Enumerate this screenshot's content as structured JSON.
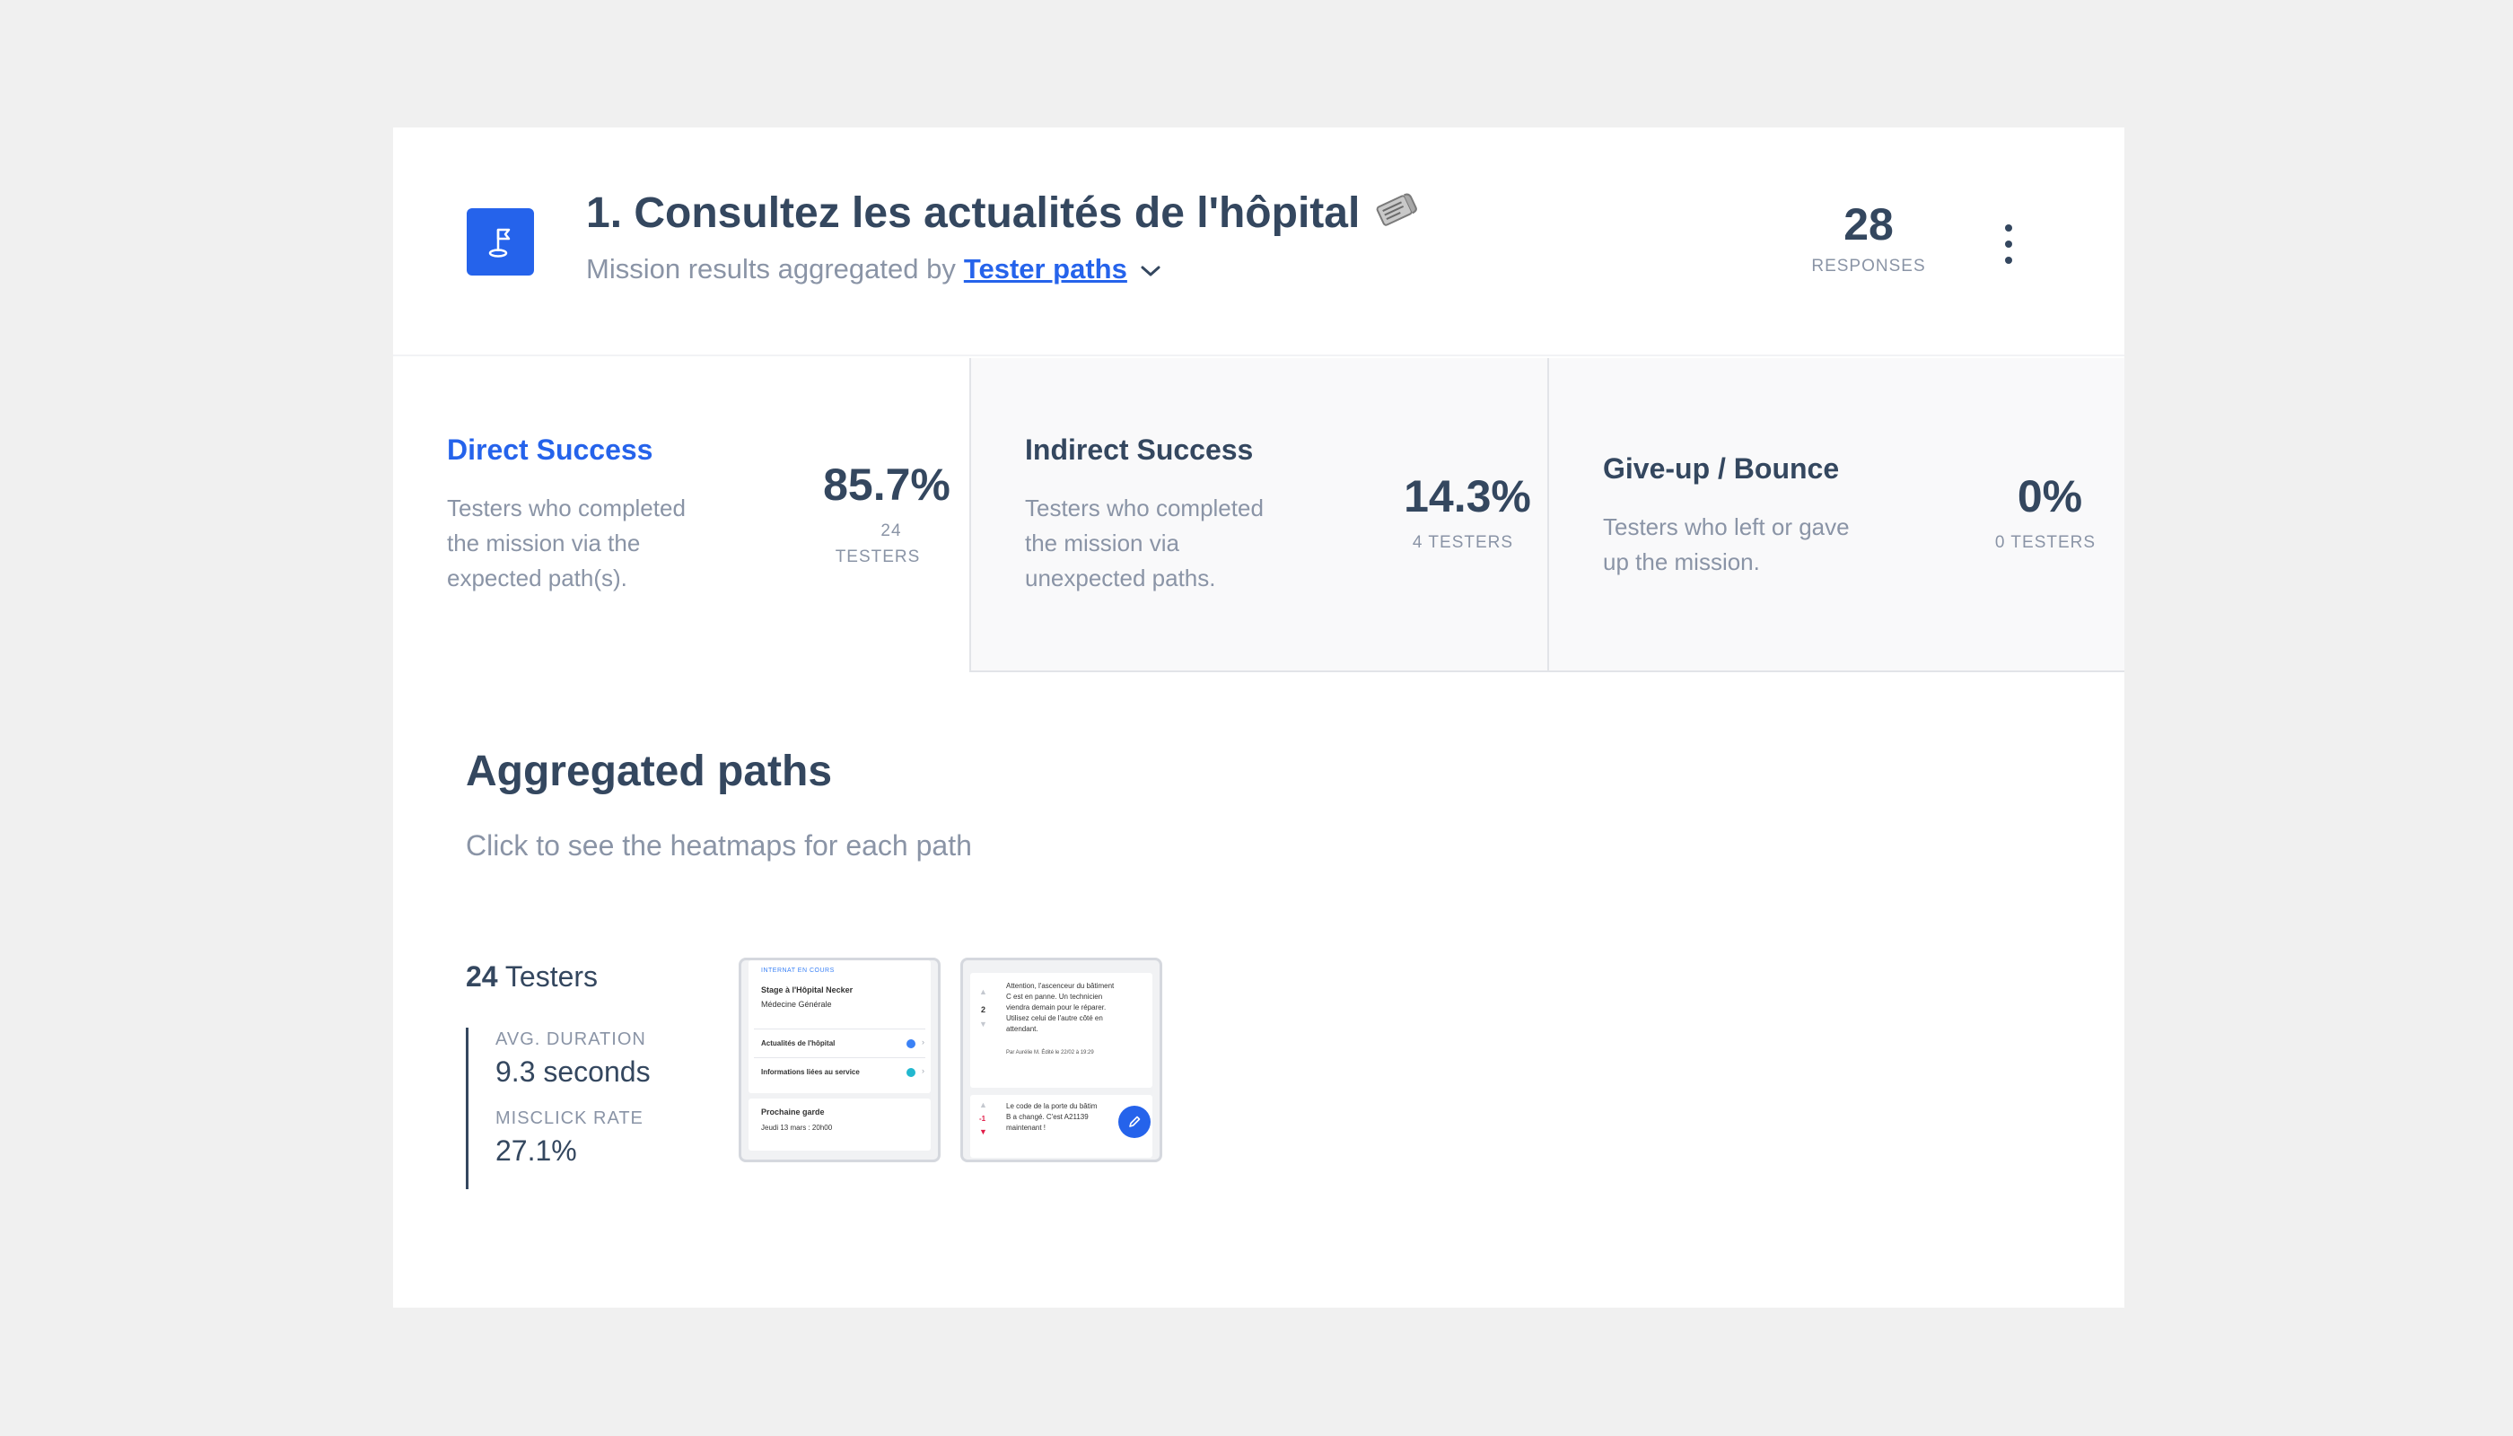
{
  "header": {
    "title": "1. Consultez les actualités de l'hôpital",
    "subtitle_prefix": "Mission results aggregated by",
    "aggregate_link": "Tester paths",
    "responses_count": "28",
    "responses_label": "RESPONSES",
    "mission_icon": "flag-pin-icon",
    "title_icon": "newspaper-icon"
  },
  "stats": [
    {
      "title": "Direct Success",
      "description": "Testers who completed the mission via the expected path(s).",
      "value": "85.7%",
      "count": "24",
      "count_label": "TESTERS"
    },
    {
      "title": "Indirect Success",
      "description": "Testers who completed the mission via unexpected paths.",
      "value": "14.3%",
      "count_label": "4 TESTERS"
    },
    {
      "title": "Give-up / Bounce",
      "description": "Testers who left or gave up the mission.",
      "value": "0%",
      "count_label": "0 TESTERS"
    }
  ],
  "aggregated": {
    "title": "Aggregated paths",
    "subtitle": "Click to see the heatmaps for each path",
    "path": {
      "count": "24",
      "count_label": "Testers",
      "avg_duration_label": "AVG. DURATION",
      "avg_duration": "9.3 seconds",
      "misclick_label": "MISCLICK RATE",
      "misclick": "27.1%"
    }
  },
  "thumb1": {
    "label": "INTERNAT EN COURS",
    "stage": "Stage à l'Hôpital Necker",
    "specialty": "Médecine Générale",
    "item1": "Actualités de l'hôpital",
    "item2": "Informations liées au service",
    "next_title": "Prochaine garde",
    "next_date": "Jeudi 13 mars : 20h00"
  },
  "thumb2": {
    "vote1": "2",
    "msg1_l1": "Attention, l'ascenceur du bâtiment",
    "msg1_l2": "C est en panne. Un technicien",
    "msg1_l3": "viendra demain pour le réparer.",
    "msg1_l4": "Utilisez celui de l'autre côté en",
    "msg1_l5": "attendant.",
    "msg1_meta": "Par Aurélie M.  Édité le 22/02 à 19:29",
    "vote2": "-1",
    "msg2_l1": "Le code de la porte du bâtim",
    "msg2_l2": "B a changé. C'est A21139",
    "msg2_l3": "maintenant !"
  },
  "colors": {
    "accent": "#2563eb",
    "text": "#34475f",
    "muted": "#8a94a6",
    "background": "#f0f0f0"
  }
}
